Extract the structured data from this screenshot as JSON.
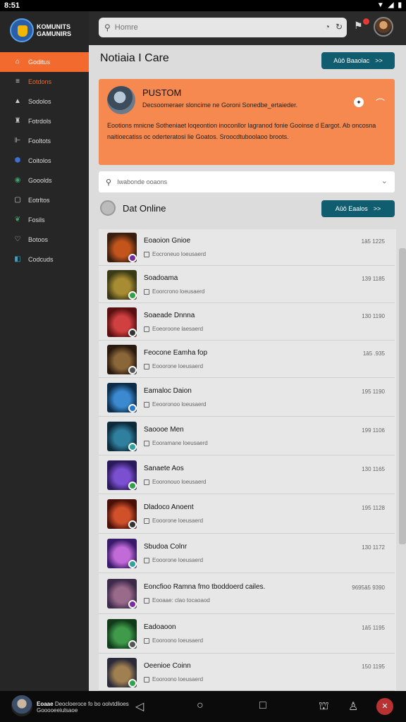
{
  "status": {
    "time": "8:51"
  },
  "brand": {
    "line1": "KOMUNITS",
    "line2": "GAMUNIRS"
  },
  "sidebar": {
    "items": [
      {
        "label": "Goditus",
        "icon": "home-icon"
      },
      {
        "label": "Eotdons",
        "icon": "list-icon"
      },
      {
        "label": "Sodolos",
        "icon": "flag-icon"
      },
      {
        "label": "Fotrdols",
        "icon": "bookmark-icon"
      },
      {
        "label": "Fooltots",
        "icon": "chart-icon"
      },
      {
        "label": "Coitolos",
        "icon": "shield-icon"
      },
      {
        "label": "Gooolds",
        "icon": "gamepad-icon"
      },
      {
        "label": "Eotrltos",
        "icon": "doc-icon"
      },
      {
        "label": "Fosils",
        "icon": "leaf-icon"
      },
      {
        "label": "Botoos",
        "icon": "heart-icon"
      },
      {
        "label": "Codcuds",
        "icon": "chat-icon"
      }
    ]
  },
  "search": {
    "placeholder": "Homre"
  },
  "page": {
    "title": "Notiaia I Care",
    "action": "Aûô Baaolac",
    "action_arrow": ">>"
  },
  "promo": {
    "title": "PUSTOM",
    "subtitle": "Decsoomeraer sloncime ne Goroni Sonedbe_ertaieder.",
    "body": "Eootions mnicne Sotheniaet loqeontion inoconllor lagranod fonie Gooinse d Eargot. Ab oncosna naitioecatiss oc oderteratosi lie Goatos. Sroocdtuboolaoo broots."
  },
  "filter": {
    "placeholder": "Iwabonde ooaons"
  },
  "section": {
    "title": "Dat Online",
    "action": "Aûô Eaalos"
  },
  "games": [
    {
      "name": "Eoaoion Gnioe",
      "status": "Eocroneuo loeusaerd",
      "value": "1â5 1225",
      "thumb": [
        "#3a1f10",
        "#c2541c"
      ],
      "badge": "#7a2ba0"
    },
    {
      "name": "Soadoama",
      "status": "Eoorcrono loeusaerd",
      "value": "139 1185",
      "thumb": [
        "#3b3a16",
        "#a88c33"
      ],
      "badge": "#2ea34a"
    },
    {
      "name": "Soaeade Dnnna",
      "status": "Eoeoroone laesaerd",
      "value": "130 1190",
      "thumb": [
        "#5a1010",
        "#d04040"
      ],
      "badge": "#333333"
    },
    {
      "name": "Feocone Eamha fop",
      "status": "Eooorone loeusaerd",
      "value": "1â5 .935",
      "thumb": [
        "#2a1a0e",
        "#8a6638"
      ],
      "badge": "#555555"
    },
    {
      "name": "Eamaloc Daion",
      "status": "Eeooronoo loeusaerd",
      "value": "195 1190",
      "thumb": [
        "#0c2d4a",
        "#3b8ad0"
      ],
      "badge": "#2979c9"
    },
    {
      "name": "Saoooe Men",
      "status": "Eooramane loeusaerd",
      "value": "199 1106",
      "thumb": [
        "#0c2a3a",
        "#2f7f9e"
      ],
      "badge": "#2ea3a0"
    },
    {
      "name": "Sanaete Aos",
      "status": "Eooronouo loeusaerd",
      "value": "130 1165",
      "thumb": [
        "#2a1a5a",
        "#7a4fd0"
      ],
      "badge": "#2ea34a"
    },
    {
      "name": "Dladoco Anoent",
      "status": "Eooorone loeusaerd",
      "value": "195 1128",
      "thumb": [
        "#4a1008",
        "#d0502a"
      ],
      "badge": "#333333"
    },
    {
      "name": "Sbudoa Colnr",
      "status": "Eooorone loeusaerd",
      "value": "130 1172",
      "thumb": [
        "#3a1a6a",
        "#c26ad8"
      ],
      "badge": "#2ea3a0"
    },
    {
      "name": "Eoncfioo Ramna fmo tboddoerd cailes.",
      "status": "Eooaae: clao tocaoaod",
      "value": "9695â5 9390",
      "thumb": [
        "#3d2a4a",
        "#9a6a8a"
      ],
      "badge": "#7a2ba0"
    },
    {
      "name": "Eadoaoon",
      "status": "Eooroono loeusaerd",
      "value": "1â5 1195",
      "thumb": [
        "#103a1a",
        "#3f9a4a"
      ],
      "badge": "#555555"
    },
    {
      "name": "Oeenioe Coinn",
      "status": "Eooroono loeusaerd",
      "value": "150 1195",
      "thumb": [
        "#2a2a3a",
        "#a08050"
      ],
      "badge": "#2ea34a"
    }
  ],
  "bottom": {
    "name": "Eoaae",
    "sub1": "Deocloeroce fo bo oolvtdlioes",
    "sub2": "Gooooeeiulsaoe"
  },
  "colors": {
    "accent": "#f26a2e",
    "promo": "#f5894f",
    "teal": "#0f5d6f",
    "sidebar": "#262626"
  }
}
